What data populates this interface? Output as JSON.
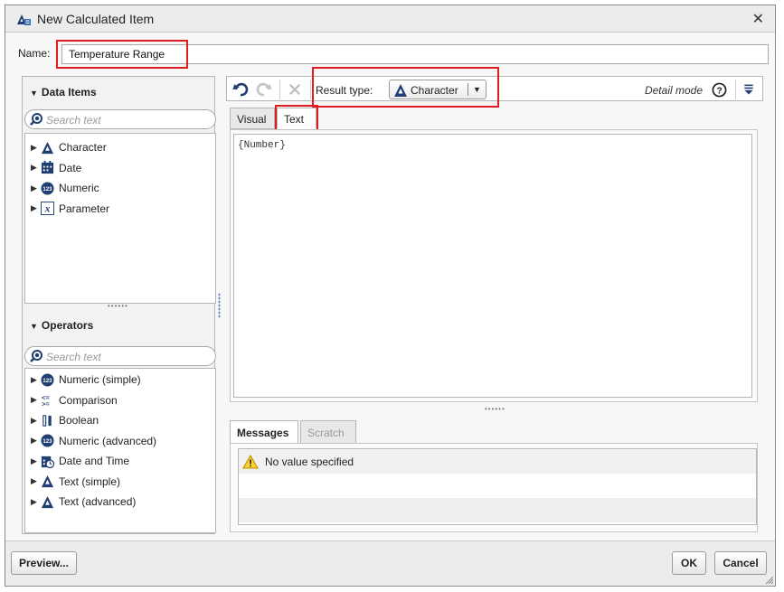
{
  "window": {
    "title": "New Calculated Item"
  },
  "name_field": {
    "label": "Name:",
    "value": "Temperature Range"
  },
  "data_items": {
    "title": "Data Items",
    "search_placeholder": "Search text",
    "items": [
      {
        "label": "Character",
        "icon": "character-icon"
      },
      {
        "label": "Date",
        "icon": "calendar-icon"
      },
      {
        "label": "Numeric",
        "icon": "numeric-icon"
      },
      {
        "label": "Parameter",
        "icon": "parameter-icon"
      }
    ]
  },
  "operators": {
    "title": "Operators",
    "search_placeholder": "Search text",
    "items": [
      {
        "label": "Numeric (simple)",
        "icon": "numeric-icon"
      },
      {
        "label": "Comparison",
        "icon": "comparison-icon"
      },
      {
        "label": "Boolean",
        "icon": "boolean-icon"
      },
      {
        "label": "Numeric (advanced)",
        "icon": "numeric-icon"
      },
      {
        "label": "Date and Time",
        "icon": "date-time-icon"
      },
      {
        "label": "Text (simple)",
        "icon": "character-icon"
      },
      {
        "label": "Text (advanced)",
        "icon": "character-icon"
      }
    ]
  },
  "toolbar": {
    "result_type_label": "Result type:",
    "result_type_value": "Character",
    "detail_mode": "Detail mode"
  },
  "editor_tabs": [
    "Visual",
    "Text"
  ],
  "expression": "{Number}",
  "bottom_tabs": [
    "Messages",
    "Scratch"
  ],
  "messages": [
    {
      "text": "No value specified",
      "icon": "warning-icon"
    }
  ],
  "buttons": {
    "preview": "Preview...",
    "ok": "OK",
    "cancel": "Cancel"
  },
  "colors": {
    "highlight": "#e01b22",
    "icon_blue": "#1f3f73"
  }
}
